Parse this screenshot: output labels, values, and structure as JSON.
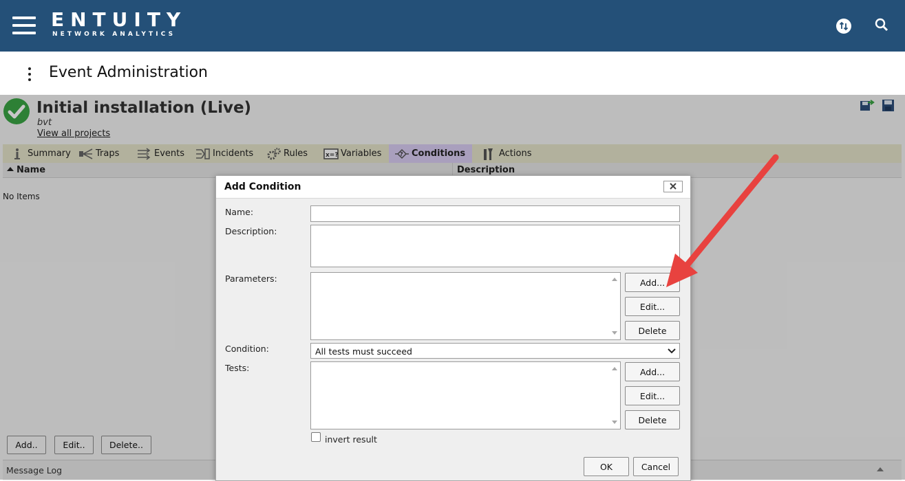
{
  "app": {
    "logo": "ENTUITY",
    "logo_sub": "NETWORK ANALYTICS",
    "brand_color": "#245078",
    "icons": [
      "menu-icon",
      "sync-icon",
      "search-icon"
    ]
  },
  "page": {
    "title": "Event Administration"
  },
  "project": {
    "title": "Initial installation (Live)",
    "subtitle": "bvt",
    "link": "View all projects",
    "status_color": "#3aa545"
  },
  "tabs": [
    {
      "label": "Summary",
      "icon": "summary-icon"
    },
    {
      "label": "Traps",
      "icon": "traps-icon"
    },
    {
      "label": "Events",
      "icon": "events-icon"
    },
    {
      "label": "Incidents",
      "icon": "incidents-icon"
    },
    {
      "label": "Rules",
      "icon": "rules-icon"
    },
    {
      "label": "Variables",
      "icon": "variables-icon"
    },
    {
      "label": "Conditions",
      "icon": "conditions-icon",
      "active": true
    },
    {
      "label": "Actions",
      "icon": "actions-icon"
    }
  ],
  "table": {
    "columns": [
      "Name",
      "Description"
    ],
    "empty_text": "No Items"
  },
  "footer_buttons": {
    "add": "Add..",
    "edit": "Edit..",
    "delete": "Delete.."
  },
  "message_log": "Message Log",
  "dialog": {
    "title": "Add Condition",
    "labels": {
      "name": "Name:",
      "description": "Description:",
      "parameters": "Parameters:",
      "condition": "Condition:",
      "tests": "Tests:"
    },
    "name_value": "",
    "description_value": "",
    "parameter_buttons": {
      "add": "Add...",
      "edit": "Edit...",
      "delete": "Delete"
    },
    "condition_selected": "All tests must succeed",
    "test_buttons": {
      "add": "Add...",
      "edit": "Edit...",
      "delete": "Delete"
    },
    "invert_label": "invert result",
    "invert_checked": false,
    "ok": "OK",
    "cancel": "Cancel"
  },
  "annotation": {
    "arrow_color": "#e8423f"
  }
}
